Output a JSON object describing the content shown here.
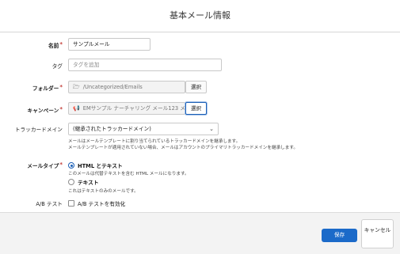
{
  "dialog": {
    "title": "基本メール情報"
  },
  "fields": {
    "name": {
      "label": "名前",
      "value": "サンプルメール"
    },
    "tag": {
      "label": "タグ",
      "placeholder": "タグを追加"
    },
    "folder": {
      "label": "フォルダー",
      "icon": "folder-icon",
      "value": "/Uncategorized/Emails",
      "button": "選択"
    },
    "campaign": {
      "label": "キャンペーン",
      "icon": "megaphone-icon",
      "value": "EMサンプル ナーチャリング メール123 メー",
      "button": "選択"
    },
    "tracker_domain": {
      "label": "トラッカードメイン",
      "selected": "(継承されたトラッカードメイン)",
      "help1": "メールはメールテンプレートに割り当てられているトラッカードメインを継承します。",
      "help2": "メールテンプレートが適用されていない場合、メールはアカウントのプライマリトラッカードメインを継承します。"
    },
    "email_type": {
      "label": "メールタイプ",
      "option1": "HTML とテキスト",
      "option1_help": "このメールは代替テキストを含む HTML メールになります。",
      "option2": "テキスト",
      "option2_help": "これはテキストのみのメールです。"
    },
    "ab_test": {
      "label": "A/B テスト",
      "checkbox": "A/B テストを有効化"
    }
  },
  "footer": {
    "save": "保存",
    "cancel": "キャンセル"
  },
  "colors": {
    "primary": "#1b6ac9",
    "required": "#c23934"
  }
}
